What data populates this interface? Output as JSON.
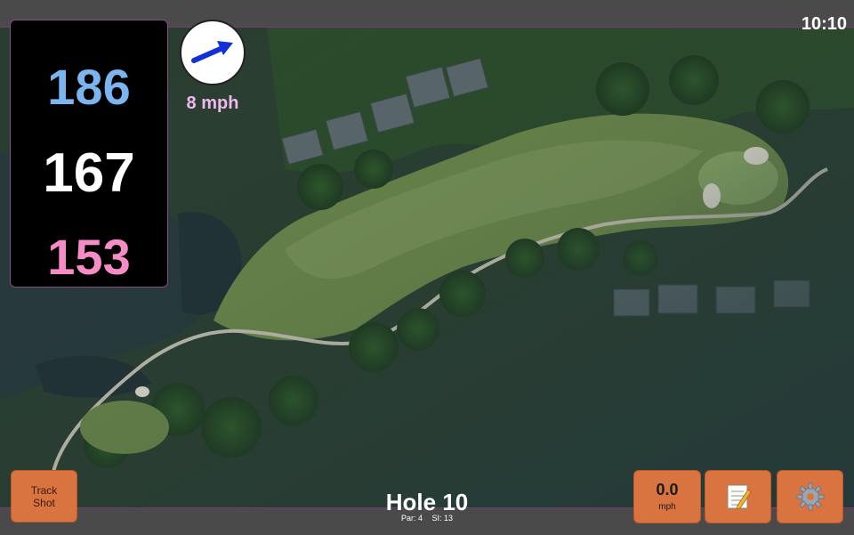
{
  "clock": "10:10",
  "distances": {
    "back": "186",
    "middle": "167",
    "front": "153"
  },
  "wind": {
    "speed_label": "8 mph",
    "direction_icon": "arrow-icon"
  },
  "hole": {
    "title": "Hole 10",
    "par_label": "Par: 4",
    "si_label": "SI: 13"
  },
  "buttons": {
    "track_shot": "Track Shot",
    "speed_value": "0.0",
    "speed_unit": "mph",
    "notes_icon": "memo-icon",
    "settings_icon": "gear-icon"
  },
  "colors": {
    "back": "#7cb4ef",
    "middle": "#ffffff",
    "front": "#f58cc6",
    "button": "#d9733f",
    "wind_label": "#f0b8f0"
  }
}
